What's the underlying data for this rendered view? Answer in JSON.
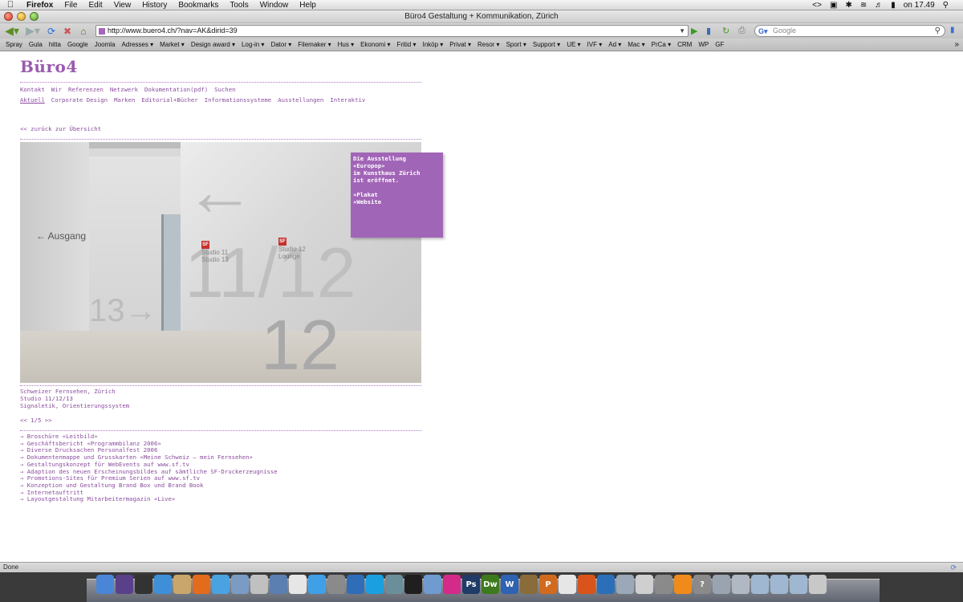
{
  "menubar": {
    "app": "Firefox",
    "items": [
      "File",
      "Edit",
      "View",
      "History",
      "Bookmarks",
      "Tools",
      "Window",
      "Help"
    ],
    "clock": "on 17.49"
  },
  "window": {
    "title": "Büro4 Gestaltung + Kommunikation, Zürich"
  },
  "toolbar": {
    "url": "http://www.buero4.ch/?nav=AK&dirid=39",
    "search_placeholder": "Google"
  },
  "bookmarks": [
    "Spray",
    "Gula",
    "hitta",
    "Google",
    "Joomla",
    "Adresses ▾",
    "Market ▾",
    "Design award ▾",
    "Log-in ▾",
    "Dator ▾",
    "Filemaker ▾",
    "Hus ▾",
    "Ekonomi ▾",
    "Fritid ▾",
    "Inköp ▾",
    "Privat ▾",
    "Resor ▾",
    "Sport ▾",
    "Support ▾",
    "UE ▾",
    "IVF ▾",
    "Ad ▾",
    "Mac ▾",
    "PrCa ▾",
    "CRM",
    "WP",
    "GF"
  ],
  "site": {
    "logo": "Büro4",
    "nav_primary": [
      "Kontakt",
      "Wir",
      "Referenzen",
      "Netzwerk",
      "Dokumentation(pdf)",
      "Suchen"
    ],
    "nav_secondary": [
      "Aktuell",
      "Corporate Design",
      "Marken",
      "Editorial+Bücher",
      "Informationssysteme",
      "Ausstellungen",
      "Interaktiv"
    ],
    "back_link": "<< zurück zur Übersicht",
    "photo": {
      "sign_ausgang": "← Ausgang",
      "sign_studio11": "Studio 11\nStudio 13",
      "sign_studio12": "Studio 12\nLounge",
      "big_number_top": "← 11/12",
      "big_number_bottom": "12 →",
      "big_number_left": "13→",
      "sf": "SF"
    },
    "infobox": {
      "line1": "Die Ausstellung",
      "line2": "«Europop»",
      "line3": "im Kunsthaus Zürich",
      "line4": "ist eröffnet.",
      "link1": "»Plakat",
      "link2": "»Website"
    },
    "caption": {
      "line1": "Schweizer Fernsehen, Zürich",
      "line2": "Studio 11/12/13",
      "line3": "Signaletik, Orientierungssystem"
    },
    "pager": "<< 1/5 >>",
    "projects": [
      "→ Broschüre «Leitbild»",
      "→ Geschäftsbericht «Programmbilanz 2006»",
      "→ Diverse Drucksachen Personalfest 2006",
      "→ Dokumentenmappe und Grusskarten «Meine Schweiz – mein Fernsehen»",
      "→ Gestaltungskonzept für WebEvents auf www.sf.tv",
      "→ Adaption des neuen Erscheinungsbildes auf sämtliche SF-Druckerzeugnisse",
      "→ Promotions-Sites für Premium Serien auf www.sf.tv",
      "→ Konzeption und Gestaltung Brand Box und Brand Book",
      "→ Internetauftritt",
      "→ Layoutgestaltung Mitarbeitermagazin «Live»"
    ]
  },
  "status": {
    "text": "Done"
  },
  "dock": {
    "icons": [
      {
        "name": "finder-icon",
        "label": "",
        "color": "#4a86d8"
      },
      {
        "name": "dashboard-icon",
        "label": "",
        "color": "#5a3f8a"
      },
      {
        "name": "clock-icon",
        "label": "",
        "color": "#333333"
      },
      {
        "name": "safari-icon",
        "label": "",
        "color": "#3f8fd8"
      },
      {
        "name": "preview-icon",
        "label": "",
        "color": "#c9a66b"
      },
      {
        "name": "firefox-icon",
        "label": "",
        "color": "#e26b1c"
      },
      {
        "name": "itunes-icon",
        "label": "",
        "color": "#4aa3e0"
      },
      {
        "name": "iphoto-icon",
        "label": "",
        "color": "#7a9cc4"
      },
      {
        "name": "star-icon",
        "label": "",
        "color": "#c0c0c0"
      },
      {
        "name": "app-icon",
        "label": "",
        "color": "#5a7fb0"
      },
      {
        "name": "textedit-icon",
        "label": "",
        "color": "#e6e6e6"
      },
      {
        "name": "ichat-icon",
        "label": "",
        "color": "#3fa0e8"
      },
      {
        "name": "photobooth-icon",
        "label": "",
        "color": "#8a8a8a"
      },
      {
        "name": "globe-icon",
        "label": "",
        "color": "#2f6db8"
      },
      {
        "name": "skype-icon",
        "label": "",
        "color": "#1aa0e0"
      },
      {
        "name": "timemachine-icon",
        "label": "",
        "color": "#6b8f9a"
      },
      {
        "name": "terminal-icon",
        "label": "",
        "color": "#1f1f1f"
      },
      {
        "name": "mail-icon",
        "label": "",
        "color": "#6f9bd0"
      },
      {
        "name": "flower-icon",
        "label": "",
        "color": "#d42a8a"
      },
      {
        "name": "photoshop-icon",
        "label": "Ps",
        "color": "#1f3b66"
      },
      {
        "name": "dreamweaver-icon",
        "label": "Dw",
        "color": "#3d7a1e"
      },
      {
        "name": "word-icon",
        "label": "W",
        "color": "#2e62b3"
      },
      {
        "name": "coffee-icon",
        "label": "",
        "color": "#8a6b3a"
      },
      {
        "name": "powerpoint-icon",
        "label": "P",
        "color": "#d26a1e"
      },
      {
        "name": "calendar-icon",
        "label": "",
        "color": "#e6e6e6"
      },
      {
        "name": "keynote-icon",
        "label": "",
        "color": "#d9541a"
      },
      {
        "name": "numbers-icon",
        "label": "",
        "color": "#2a6fb8"
      },
      {
        "name": "pen-icon",
        "label": "",
        "color": "#9aa8b8"
      },
      {
        "name": "ipod-icon",
        "label": "",
        "color": "#cfcfcf"
      },
      {
        "name": "database-icon",
        "label": "",
        "color": "#8a8a8a"
      },
      {
        "name": "vlc-icon",
        "label": "",
        "color": "#f08a1a"
      },
      {
        "name": "help-icon",
        "label": "?",
        "color": "#8a8a8a"
      },
      {
        "name": "screenshot-icon",
        "label": "",
        "color": "#9aa4b0"
      },
      {
        "name": "network-icon",
        "label": "",
        "color": "#b0b8c4"
      },
      {
        "name": "folder-icon",
        "label": "",
        "color": "#9fb7d0"
      },
      {
        "name": "downloads-icon",
        "label": "",
        "color": "#9fb7d0"
      },
      {
        "name": "documents-icon",
        "label": "",
        "color": "#9fb7d0"
      },
      {
        "name": "trash-icon",
        "label": "",
        "color": "#c8c8c8"
      }
    ]
  }
}
